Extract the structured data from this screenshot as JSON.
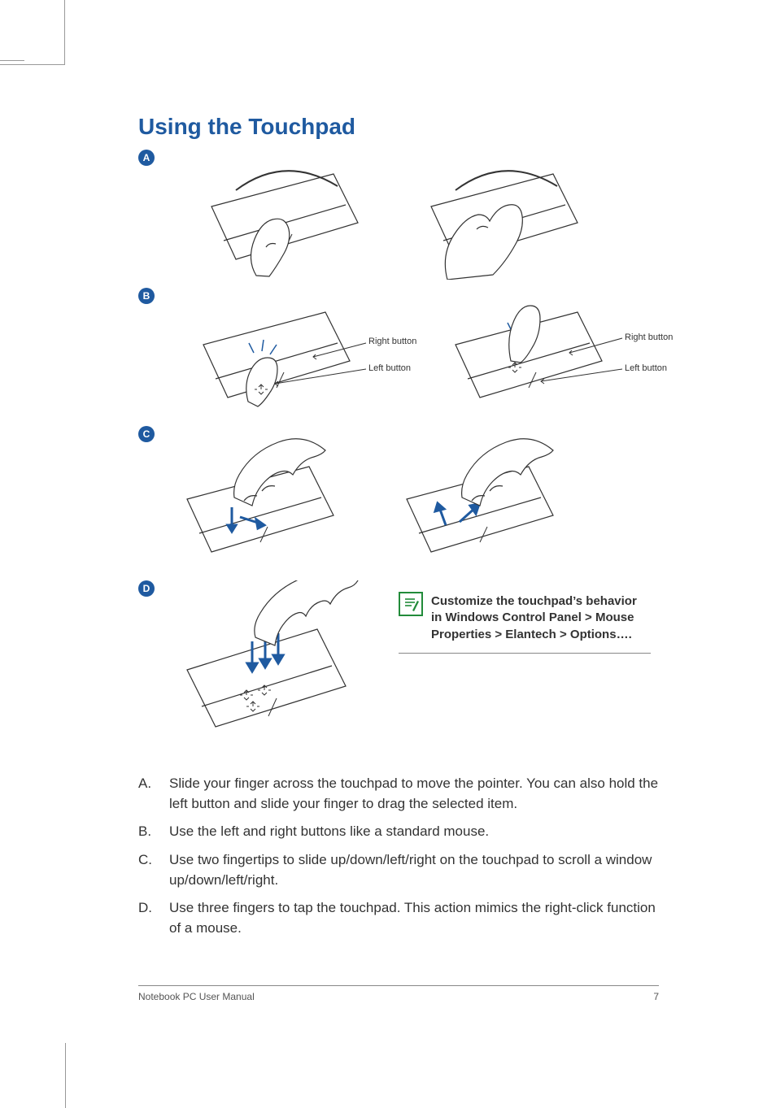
{
  "title": "Using the Touchpad",
  "badges": {
    "a": "A",
    "b": "B",
    "c": "C",
    "d": "D"
  },
  "labels": {
    "right_button": "Right button",
    "left_button": "Left button"
  },
  "note": {
    "text": "Customize the touchpad’s behavior in Windows Control Panel > Mouse Properties > Elantech > Options…."
  },
  "items": {
    "a": "Slide your finger across the touchpad to move the pointer. You can also hold the left button and slide your finger to drag the selected item.",
    "b": "Use the left and right buttons like a standard mouse.",
    "c": "Use two fingertips to slide up/down/left/right on the touchpad to scroll a window up/down/left/right.",
    "d": "Use three fingers to tap the touchpad. This action mimics the right-click function of a mouse."
  },
  "letters": {
    "a": "A.",
    "b": "B.",
    "c": "C.",
    "d": "D."
  },
  "footer": {
    "title": "Notebook PC User Manual",
    "page": "7"
  }
}
